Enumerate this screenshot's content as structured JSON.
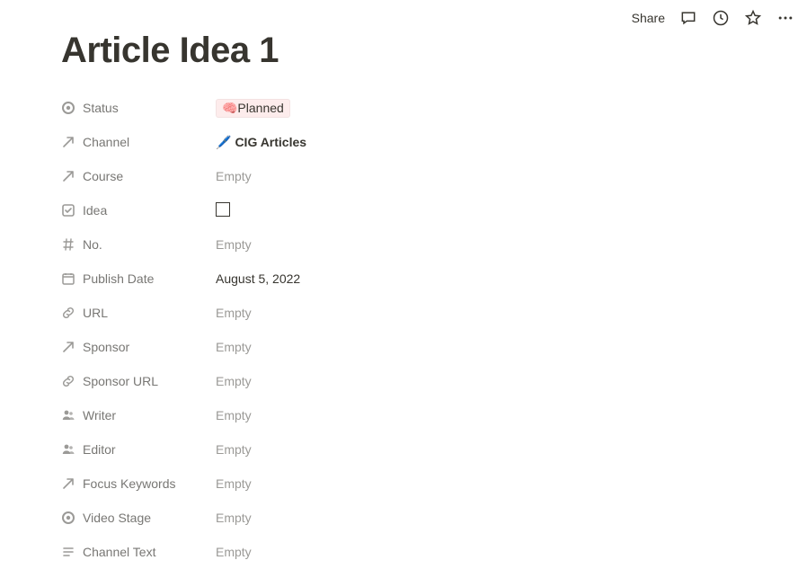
{
  "topbar": {
    "share_label": "Share"
  },
  "page": {
    "title": "Article Idea 1"
  },
  "properties": [
    {
      "key": "status",
      "icon": "status",
      "label": "Status",
      "type": "status",
      "value": "Planned",
      "emoji": "🧠"
    },
    {
      "key": "channel",
      "icon": "relation",
      "label": "Channel",
      "type": "relation",
      "value": "CIG Articles",
      "rel_emoji": "🖊️"
    },
    {
      "key": "course",
      "icon": "relation",
      "label": "Course",
      "type": "empty",
      "value": "Empty"
    },
    {
      "key": "idea",
      "icon": "checkbox",
      "label": "Idea",
      "type": "checkbox",
      "checked": false
    },
    {
      "key": "no",
      "icon": "number",
      "label": "No.",
      "type": "empty",
      "value": "Empty"
    },
    {
      "key": "publish_date",
      "icon": "date",
      "label": "Publish Date",
      "type": "text",
      "value": "August 5, 2022"
    },
    {
      "key": "url",
      "icon": "url",
      "label": "URL",
      "type": "empty",
      "value": "Empty"
    },
    {
      "key": "sponsor",
      "icon": "relation",
      "label": "Sponsor",
      "type": "empty",
      "value": "Empty"
    },
    {
      "key": "sponsor_url",
      "icon": "url",
      "label": "Sponsor URL",
      "type": "empty",
      "value": "Empty"
    },
    {
      "key": "writer",
      "icon": "person",
      "label": "Writer",
      "type": "empty",
      "value": "Empty"
    },
    {
      "key": "editor",
      "icon": "person",
      "label": "Editor",
      "type": "empty",
      "value": "Empty"
    },
    {
      "key": "focus_keywords",
      "icon": "relation",
      "label": "Focus Keywords",
      "type": "empty",
      "value": "Empty"
    },
    {
      "key": "video_stage",
      "icon": "status",
      "label": "Video Stage",
      "type": "empty",
      "value": "Empty"
    },
    {
      "key": "channel_text",
      "icon": "text",
      "label": "Channel Text",
      "type": "empty",
      "value": "Empty"
    }
  ],
  "empty_text": "Empty"
}
